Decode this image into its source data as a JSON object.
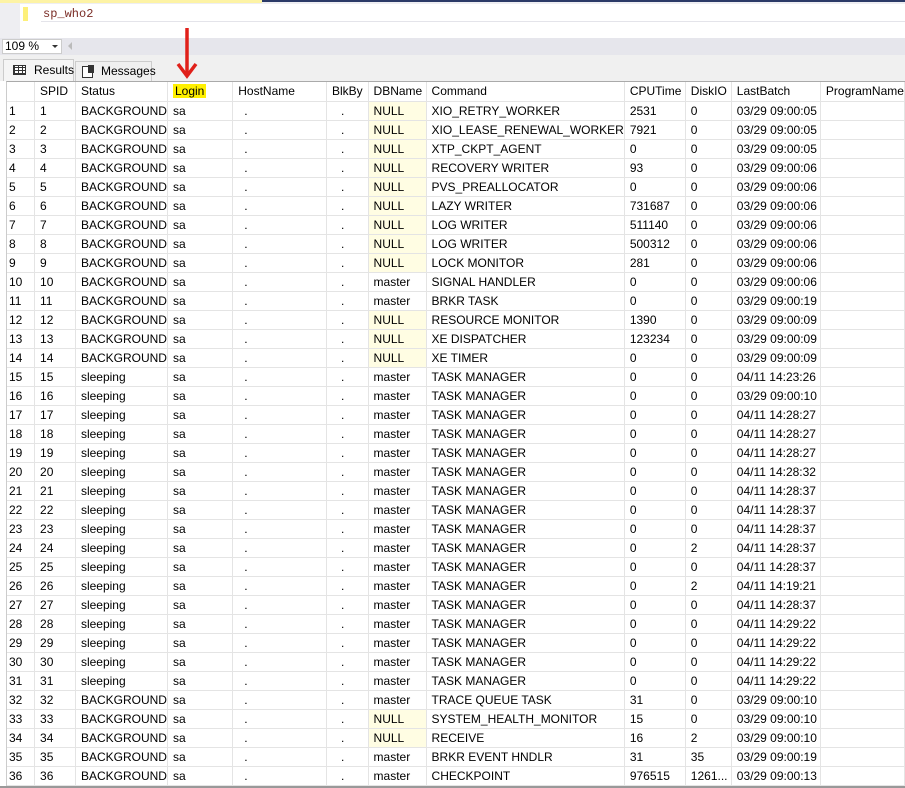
{
  "editor": {
    "query": "sp_who2"
  },
  "zoom": {
    "value": "109 %"
  },
  "tabs": {
    "results": "Results",
    "messages": "Messages"
  },
  "grid": {
    "columns": [
      "",
      "SPID",
      "Status",
      "Login",
      "HostName",
      "BlkBy",
      "DBName",
      "Command",
      "CPUTime",
      "DiskIO",
      "LastBatch",
      "ProgramName"
    ],
    "highlighted_column": "Login",
    "rows": [
      [
        "1",
        "1",
        "BACKGROUND",
        "sa",
        ".",
        ".",
        "NULL",
        "XIO_RETRY_WORKER",
        "2531",
        "0",
        "03/29 09:00:05",
        ""
      ],
      [
        "2",
        "2",
        "BACKGROUND",
        "sa",
        ".",
        ".",
        "NULL",
        "XIO_LEASE_RENEWAL_WORKER",
        "7921",
        "0",
        "03/29 09:00:05",
        ""
      ],
      [
        "3",
        "3",
        "BACKGROUND",
        "sa",
        ".",
        ".",
        "NULL",
        "XTP_CKPT_AGENT",
        "0",
        "0",
        "03/29 09:00:05",
        ""
      ],
      [
        "4",
        "4",
        "BACKGROUND",
        "sa",
        ".",
        ".",
        "NULL",
        "RECOVERY WRITER",
        "93",
        "0",
        "03/29 09:00:06",
        ""
      ],
      [
        "5",
        "5",
        "BACKGROUND",
        "sa",
        ".",
        ".",
        "NULL",
        "PVS_PREALLOCATOR",
        "0",
        "0",
        "03/29 09:00:06",
        ""
      ],
      [
        "6",
        "6",
        "BACKGROUND",
        "sa",
        ".",
        ".",
        "NULL",
        "LAZY WRITER",
        "731687",
        "0",
        "03/29 09:00:06",
        ""
      ],
      [
        "7",
        "7",
        "BACKGROUND",
        "sa",
        ".",
        ".",
        "NULL",
        "LOG WRITER",
        "511140",
        "0",
        "03/29 09:00:06",
        ""
      ],
      [
        "8",
        "8",
        "BACKGROUND",
        "sa",
        ".",
        ".",
        "NULL",
        "LOG WRITER",
        "500312",
        "0",
        "03/29 09:00:06",
        ""
      ],
      [
        "9",
        "9",
        "BACKGROUND",
        "sa",
        ".",
        ".",
        "NULL",
        "LOCK MONITOR",
        "281",
        "0",
        "03/29 09:00:06",
        ""
      ],
      [
        "10",
        "10",
        "BACKGROUND",
        "sa",
        ".",
        ".",
        "master",
        "SIGNAL HANDLER",
        "0",
        "0",
        "03/29 09:00:06",
        ""
      ],
      [
        "11",
        "11",
        "BACKGROUND",
        "sa",
        ".",
        ".",
        "master",
        "BRKR TASK",
        "0",
        "0",
        "03/29 09:00:19",
        ""
      ],
      [
        "12",
        "12",
        "BACKGROUND",
        "sa",
        ".",
        ".",
        "NULL",
        "RESOURCE MONITOR",
        "1390",
        "0",
        "03/29 09:00:09",
        ""
      ],
      [
        "13",
        "13",
        "BACKGROUND",
        "sa",
        ".",
        ".",
        "NULL",
        "XE DISPATCHER",
        "123234",
        "0",
        "03/29 09:00:09",
        ""
      ],
      [
        "14",
        "14",
        "BACKGROUND",
        "sa",
        ".",
        ".",
        "NULL",
        "XE TIMER",
        "0",
        "0",
        "03/29 09:00:09",
        ""
      ],
      [
        "15",
        "15",
        "sleeping",
        "sa",
        ".",
        ".",
        "master",
        "TASK MANAGER",
        "0",
        "0",
        "04/11 14:23:26",
        ""
      ],
      [
        "16",
        "16",
        "sleeping",
        "sa",
        ".",
        ".",
        "master",
        "TASK MANAGER",
        "0",
        "0",
        "03/29 09:00:10",
        ""
      ],
      [
        "17",
        "17",
        "sleeping",
        "sa",
        ".",
        ".",
        "master",
        "TASK MANAGER",
        "0",
        "0",
        "04/11 14:28:27",
        ""
      ],
      [
        "18",
        "18",
        "sleeping",
        "sa",
        ".",
        ".",
        "master",
        "TASK MANAGER",
        "0",
        "0",
        "04/11 14:28:27",
        ""
      ],
      [
        "19",
        "19",
        "sleeping",
        "sa",
        ".",
        ".",
        "master",
        "TASK MANAGER",
        "0",
        "0",
        "04/11 14:28:27",
        ""
      ],
      [
        "20",
        "20",
        "sleeping",
        "sa",
        ".",
        ".",
        "master",
        "TASK MANAGER",
        "0",
        "0",
        "04/11 14:28:32",
        ""
      ],
      [
        "21",
        "21",
        "sleeping",
        "sa",
        ".",
        ".",
        "master",
        "TASK MANAGER",
        "0",
        "0",
        "04/11 14:28:37",
        ""
      ],
      [
        "22",
        "22",
        "sleeping",
        "sa",
        ".",
        ".",
        "master",
        "TASK MANAGER",
        "0",
        "0",
        "04/11 14:28:37",
        ""
      ],
      [
        "23",
        "23",
        "sleeping",
        "sa",
        ".",
        ".",
        "master",
        "TASK MANAGER",
        "0",
        "0",
        "04/11 14:28:37",
        ""
      ],
      [
        "24",
        "24",
        "sleeping",
        "sa",
        ".",
        ".",
        "master",
        "TASK MANAGER",
        "0",
        "2",
        "04/11 14:28:37",
        ""
      ],
      [
        "25",
        "25",
        "sleeping",
        "sa",
        ".",
        ".",
        "master",
        "TASK MANAGER",
        "0",
        "0",
        "04/11 14:28:37",
        ""
      ],
      [
        "26",
        "26",
        "sleeping",
        "sa",
        ".",
        ".",
        "master",
        "TASK MANAGER",
        "0",
        "2",
        "04/11 14:19:21",
        ""
      ],
      [
        "27",
        "27",
        "sleeping",
        "sa",
        ".",
        ".",
        "master",
        "TASK MANAGER",
        "0",
        "0",
        "04/11 14:28:37",
        ""
      ],
      [
        "28",
        "28",
        "sleeping",
        "sa",
        ".",
        ".",
        "master",
        "TASK MANAGER",
        "0",
        "0",
        "04/11 14:29:22",
        ""
      ],
      [
        "29",
        "29",
        "sleeping",
        "sa",
        ".",
        ".",
        "master",
        "TASK MANAGER",
        "0",
        "0",
        "04/11 14:29:22",
        ""
      ],
      [
        "30",
        "30",
        "sleeping",
        "sa",
        ".",
        ".",
        "master",
        "TASK MANAGER",
        "0",
        "0",
        "04/11 14:29:22",
        ""
      ],
      [
        "31",
        "31",
        "sleeping",
        "sa",
        ".",
        ".",
        "master",
        "TASK MANAGER",
        "0",
        "0",
        "04/11 14:29:22",
        ""
      ],
      [
        "32",
        "32",
        "BACKGROUND",
        "sa",
        ".",
        ".",
        "master",
        "TRACE QUEUE TASK",
        "31",
        "0",
        "03/29 09:00:10",
        ""
      ],
      [
        "33",
        "33",
        "BACKGROUND",
        "sa",
        ".",
        ".",
        "NULL",
        "SYSTEM_HEALTH_MONITOR",
        "15",
        "0",
        "03/29 09:00:10",
        ""
      ],
      [
        "34",
        "34",
        "BACKGROUND",
        "sa",
        ".",
        ".",
        "NULL",
        "RECEIVE",
        "16",
        "2",
        "03/29 09:00:10",
        ""
      ],
      [
        "35",
        "35",
        "BACKGROUND",
        "sa",
        ".",
        ".",
        "master",
        "BRKR EVENT HNDLR",
        "31",
        "35",
        "03/29 09:00:19",
        ""
      ],
      [
        "36",
        "36",
        "BACKGROUND",
        "sa",
        ".",
        ".",
        "master",
        "CHECKPOINT",
        "976515",
        "1261...",
        "03/29 09:00:13",
        ""
      ]
    ]
  },
  "colors": {
    "null_bg": "#fffde3",
    "highlight": "#fff000",
    "arrow": "#e0201a"
  }
}
